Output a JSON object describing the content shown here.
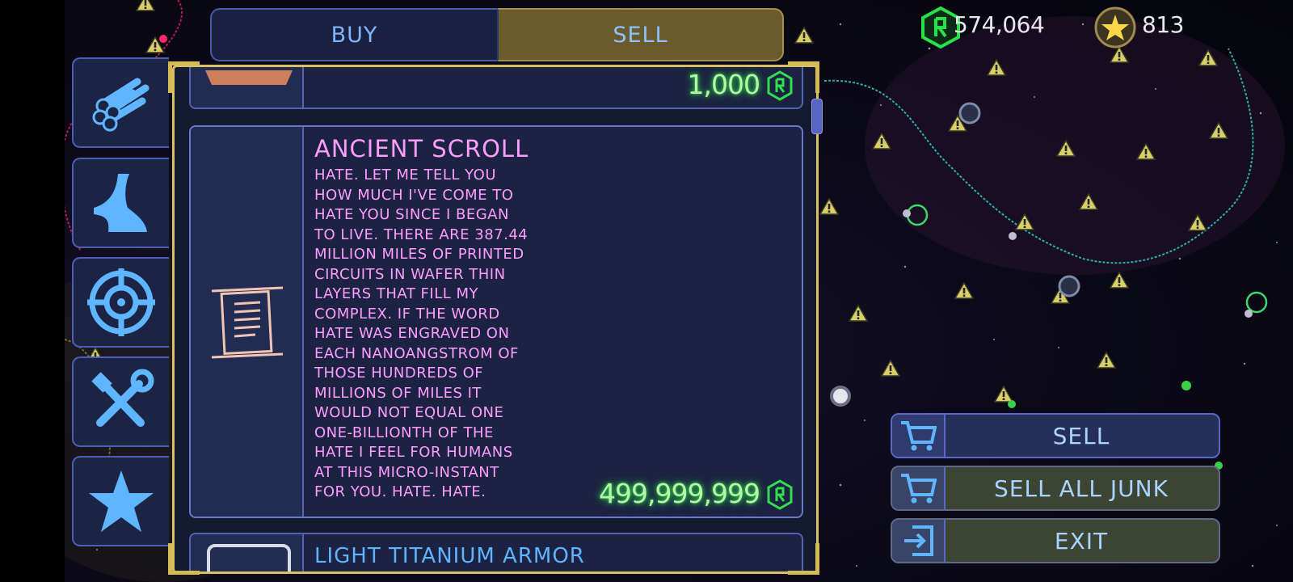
{
  "tabs": {
    "buy": "BUY",
    "sell": "SELL",
    "active": "sell"
  },
  "currency": {
    "credits": "574,064",
    "stars": "813",
    "credit_color": "#27e04a",
    "star_color": "#ffd84a"
  },
  "categories": [
    {
      "icon": "pipes-icon"
    },
    {
      "icon": "anvil-icon"
    },
    {
      "icon": "target-icon"
    },
    {
      "icon": "tools-icon"
    },
    {
      "icon": "star-icon"
    }
  ],
  "items": [
    {
      "price": "1,000"
    },
    {
      "name": "ANCIENT SCROLL",
      "description": "HATE. LET ME TELL YOU\nHOW MUCH I'VE COME TO\nHATE YOU SINCE I BEGAN\nTO LIVE. THERE ARE 387.44\nMILLION MILES OF PRINTED\nCIRCUITS IN WAFER THIN\nLAYERS THAT FILL MY\nCOMPLEX. IF THE WORD\nHATE WAS ENGRAVED ON\nEACH NANOANGSTROM OF\nTHOSE HUNDREDS OF\nMILLIONS OF MILES IT\nWOULD NOT EQUAL ONE\nONE-BILLIONTH OF THE\nHATE I FEEL FOR HUMANS\nAT THIS MICRO-INSTANT\nFOR YOU. HATE. HATE.",
      "price": "499,999,999",
      "icon": "scroll-icon"
    },
    {
      "name": "LIGHT TITANIUM ARMOR"
    }
  ],
  "actions": {
    "sell": "SELL",
    "sell_all_junk": "SELL ALL JUNK",
    "exit": "EXIT"
  }
}
